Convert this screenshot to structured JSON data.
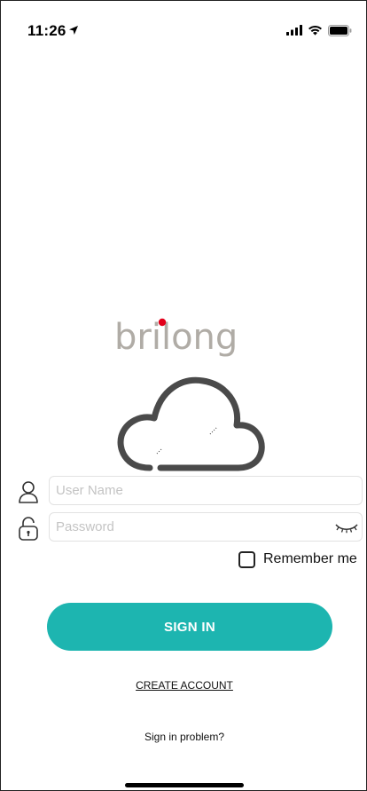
{
  "status_bar": {
    "time": "11:26",
    "icons": [
      "location-arrow-icon",
      "cellular-signal-icon",
      "wifi-icon",
      "battery-icon"
    ]
  },
  "brand": {
    "name": "brilong",
    "accent_color": "#e3001b",
    "text_color": "#b0aca6",
    "cloud_color": "#4a4a4a"
  },
  "form": {
    "username": {
      "placeholder": "User Name",
      "value": "",
      "icon": "user-icon"
    },
    "password": {
      "placeholder": "Password",
      "value": "",
      "icon": "lock-icon",
      "toggle_icon": "eye-closed-icon"
    },
    "remember": {
      "label": "Remember me",
      "checked": false
    }
  },
  "actions": {
    "sign_in_label": "SIGN IN",
    "sign_in_color": "#1db5b0",
    "create_account_label": "CREATE ACCOUNT",
    "sign_in_problem_label": "Sign in problem?"
  }
}
